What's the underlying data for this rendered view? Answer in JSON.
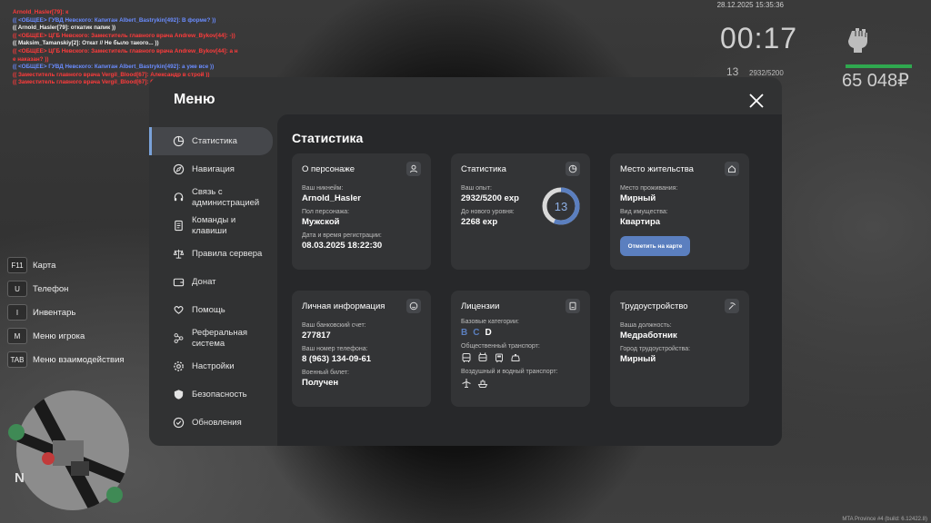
{
  "chat": [
    {
      "color": "red",
      "text": "Arnold_Hasler[79]: к"
    },
    {
      "color": "blue",
      "text": "(( <ОБЩЕЕ> ГУВД Невского: Капитан Albert_Bastrykin[492]: В форме? ))"
    },
    {
      "color": "white",
      "text": "(( Arnold_Hasler[79]: откатик папик ))"
    },
    {
      "color": "red",
      "text": "(( <ОБЩЕЕ> ЦГБ Невского: Заместитель главного врача Andrew_Bykov[44]: -))"
    },
    {
      "color": "white",
      "text": "(( Maksim_Tamanskiy[2]: Откат // Не было такого... ))"
    },
    {
      "color": "red",
      "text": "(( <ОБЩЕЕ> ЦГБ Невского: Заместитель главного врача Andrew_Bykov[44]: а н"
    },
    {
      "color": "red",
      "text": "е наказан? ))"
    },
    {
      "color": "blue",
      "text": "(( <ОБЩЕЕ> ГУВД Невского: Капитан Albert_Bastrykin[492]: а уже все ))"
    },
    {
      "color": "red",
      "text": "(( Заместитель главного врача Vergil_Blood[67]: Александр в строй ))"
    },
    {
      "color": "red",
      "text": "(( Заместитель главного врача Vergil_Blood[67]: Семен прими ))"
    }
  ],
  "hud": {
    "date": "28.12.2025 15:35:36",
    "timer": "00:17",
    "level": "13",
    "exp": "2932/5200",
    "money": "65 048₽",
    "health_fraction": 1.0
  },
  "binds": [
    {
      "key": "F11",
      "label": "Карта"
    },
    {
      "key": "U",
      "label": "Телефон"
    },
    {
      "key": "I",
      "label": "Инвентарь"
    },
    {
      "key": "M",
      "label": "Меню игрока"
    },
    {
      "key": "TAB",
      "label": "Меню взаимодействия"
    }
  ],
  "minimap": {
    "north": "N"
  },
  "build": "MTA Province #4 (build: 6.12422.8)",
  "menu": {
    "title": "Меню",
    "nav": [
      {
        "id": "stats",
        "icon": "pie-chart-icon",
        "label": "Статистика",
        "active": true
      },
      {
        "id": "navigation",
        "icon": "compass-icon",
        "label": "Навигация"
      },
      {
        "id": "admin",
        "icon": "headset-icon",
        "label": "Связь с администрацией"
      },
      {
        "id": "commands",
        "icon": "document-icon",
        "label": "Команды и клавиши"
      },
      {
        "id": "rules",
        "icon": "scales-icon",
        "label": "Правила сервера"
      },
      {
        "id": "donate",
        "icon": "wallet-icon",
        "label": "Донат"
      },
      {
        "id": "help",
        "icon": "heart-hand-icon",
        "label": "Помощь"
      },
      {
        "id": "referral",
        "icon": "network-icon",
        "label": "Реферальная система"
      },
      {
        "id": "settings",
        "icon": "gear-icon",
        "label": "Настройки"
      },
      {
        "id": "security",
        "icon": "shield-icon",
        "label": "Безопасность"
      },
      {
        "id": "updates",
        "icon": "refresh-check-icon",
        "label": "Обновления"
      }
    ],
    "content_title": "Статистика",
    "cards": {
      "about": {
        "title": "О персонаже",
        "nick_label": "Ваш никнейм:",
        "nick": "Arnold_Hasler",
        "gender_label": "Пол персонажа:",
        "gender": "Мужской",
        "reg_label": "Дата и время регистрации:",
        "reg": "08.03.2025 18:22:30"
      },
      "stats": {
        "title": "Статистика",
        "exp_label": "Ваш опыт:",
        "exp": "2932/5200 exp",
        "next_label": "До нового уровня:",
        "next": "2268 exp",
        "level": "13",
        "progress": 0.5638
      },
      "residence": {
        "title": "Место жительства",
        "place_label": "Место проживания:",
        "place": "Мирный",
        "property_label": "Вид имущества:",
        "property": "Квартира",
        "button": "Отметить на карте"
      },
      "personal": {
        "title": "Личная информация",
        "bank_label": "Ваш банковский счет:",
        "bank": "277817",
        "phone_label": "Ваш номер телефона:",
        "phone": "8 (963) 134-09-61",
        "military_label": "Военный билет:",
        "military": "Получен"
      },
      "licenses": {
        "title": "Лицензии",
        "base_label": "Базовые категории:",
        "categories": [
          {
            "name": "B",
            "owned": false
          },
          {
            "name": "C",
            "owned": false
          },
          {
            "name": "D",
            "owned": true
          }
        ],
        "public_label": "Общественный транспорт:",
        "air_label": "Воздушный и водный транспорт:",
        "accent": "#5b7fbf"
      },
      "job": {
        "title": "Трудоустройство",
        "position_label": "Ваша должность:",
        "position": "Медработник",
        "city_label": "Город трудоустройства:",
        "city": "Мирный"
      }
    }
  }
}
